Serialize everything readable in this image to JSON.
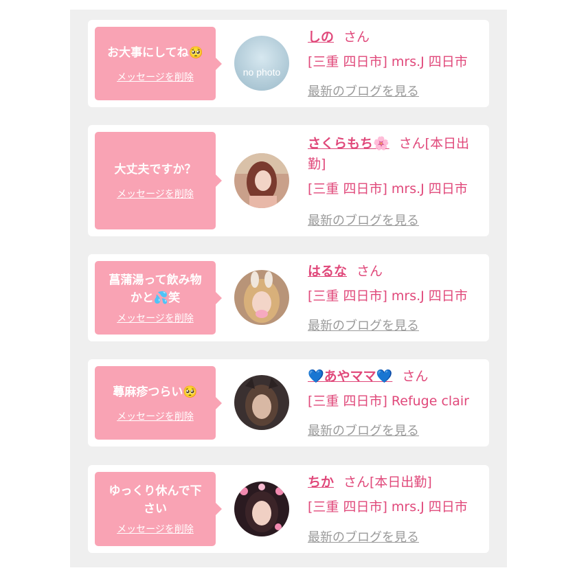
{
  "colors": {
    "bubble": "#f9a3b4",
    "name": "#e0487a",
    "link_gray": "#9a9a9a",
    "panel": "#efefef"
  },
  "items": [
    {
      "message_lines": [
        "お大事にしてね🥺"
      ],
      "delete_label": "メッセージを削除",
      "avatar_text": "no photo",
      "name": "しの",
      "suffix": "さん",
      "shop": "[三重 四日市] mrs.J 四日市",
      "blog_link": "最新のブログを見る"
    },
    {
      "message_lines": [
        "大丈夫ですか？"
      ],
      "delete_label": "メッセージを削除",
      "avatar_text": "",
      "name": "さくらもち🌸",
      "suffix": "さん[本日出勤]",
      "shop": "[三重 四日市] mrs.J 四日市",
      "blog_link": "最新のブログを見る"
    },
    {
      "message_lines": [
        "菖蒲湯って飲み物",
        "かと💦笑"
      ],
      "delete_label": "メッセージを削除",
      "avatar_text": "",
      "name": "はるな",
      "suffix": "さん",
      "shop": "[三重 四日市] mrs.J 四日市",
      "blog_link": "最新のブログを見る"
    },
    {
      "message_lines": [
        "蕁麻疹つらい🥺"
      ],
      "delete_label": "メッセージを削除",
      "avatar_text": "",
      "name": "💙あやママ💙",
      "suffix": "さん",
      "shop": "[三重 四日市] Refuge clair",
      "blog_link": "最新のブログを見る"
    },
    {
      "message_lines": [
        "ゆっくり休んで下",
        "さい"
      ],
      "delete_label": "メッセージを削除",
      "avatar_text": "",
      "name": "ちか",
      "suffix": "さん[本日出勤]",
      "shop": "[三重 四日市] mrs.J 四日市",
      "blog_link": "最新のブログを見る"
    }
  ]
}
